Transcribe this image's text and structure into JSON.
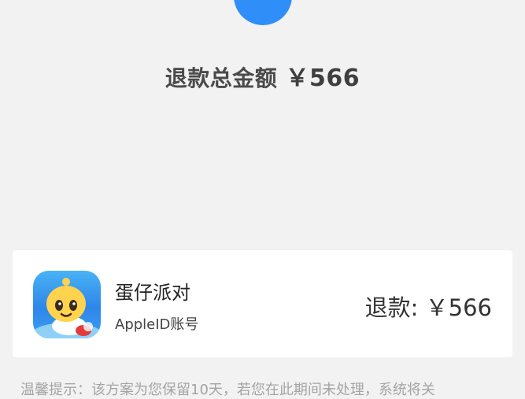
{
  "header": {
    "status_icon": "check-circle-icon",
    "total_label": "退款总金额",
    "total_amount": "￥566"
  },
  "refund_item": {
    "app_icon": "egg-party-app-icon",
    "app_name": "蛋仔派对",
    "account_type": "AppleID账号",
    "refund_label": "退款:",
    "refund_amount": "￥566"
  },
  "footer": {
    "tip_text": "温馨提示：该方案为您保留10天，若您在此期间未处理，系统将关"
  },
  "colors": {
    "accent": "#2f8ef8",
    "background": "#f2f2f2",
    "card": "#ffffff",
    "tip_text": "#a4a4a4"
  }
}
